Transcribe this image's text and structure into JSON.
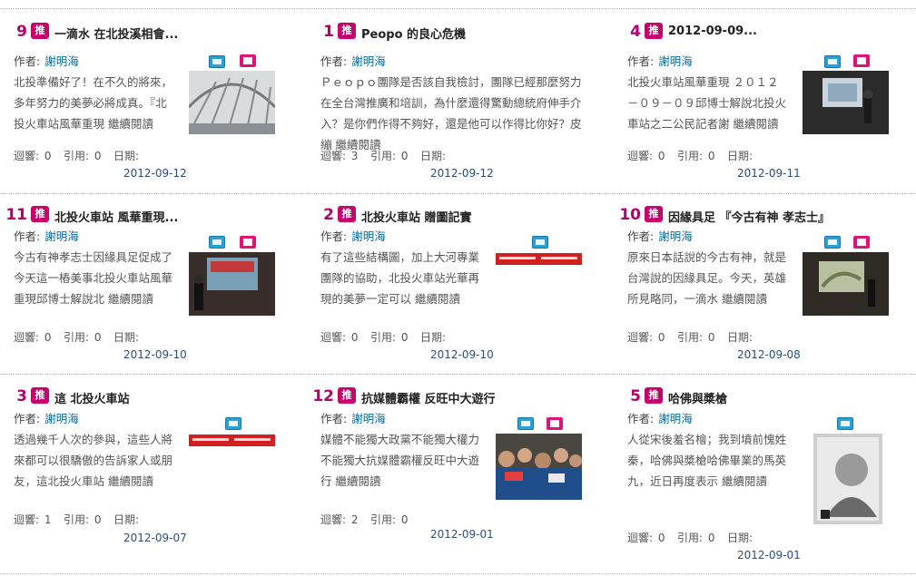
{
  "tui_label": "推",
  "author_label": "作者:",
  "reply_label": "迴響:",
  "cite_label": "引用:",
  "date_label": "日期:",
  "cards": [
    {
      "rank": "9",
      "title": "一滴水 在北投溪相會...",
      "author": "謝明海",
      "summary": "北投準備好了！在不久的將來，多年努力的美夢必將成真。『北投火車站風華重現 繼續閱讀",
      "replies": "0",
      "cites": "0",
      "date": "2012-09-12"
    },
    {
      "rank": "1",
      "title": "Peopo 的良心危機",
      "author": "謝明海",
      "summary": "Ｐｅｏｐｏ團隊是否該自我檢討，團隊已經那麼努力在全台灣推廣和培訓，為什麼還得驚動總統府伸手介入？是你們作得不夠好，還是他可以作得比你好？皮繃 繼續閱讀",
      "replies": "3",
      "cites": "0",
      "date": "2012-09-12"
    },
    {
      "rank": "4",
      "title": "2012-09-09...",
      "author": "謝明海",
      "summary": "北投火車站風華重現 ２０１２－０９－０９邱博士解說北投火車站之二公民記者謝 繼續閱讀",
      "replies": "0",
      "cites": "0",
      "date": "2012-09-11"
    },
    {
      "rank": "11",
      "title": "北投火車站 風華重現...",
      "author": "謝明海",
      "summary": "今古有神孝志士因緣具足促成了今天這一樁美事北投火車站風華重現邱博士解說北 繼續閱讀",
      "replies": "0",
      "cites": "0",
      "date": "2012-09-10"
    },
    {
      "rank": "2",
      "title": "北投火車站 贈圖記實",
      "author": "謝明海",
      "summary": "有了這些結構圖，加上大河專業團隊的協助，北投火車站光華再現的美夢一定可以 繼續閱讀",
      "replies": "0",
      "cites": "0",
      "date": "2012-09-10"
    },
    {
      "rank": "10",
      "title": "因緣具足 『今古有神 孝志士』",
      "author": "謝明海",
      "summary": "原來日本話說的今古有神，就是台灣說的因緣具足。今天，英雄所見略同，一滴水 繼續閱讀",
      "replies": "0",
      "cites": "0",
      "date": "2012-09-08"
    },
    {
      "rank": "3",
      "title": "這 北投火車站",
      "author": "謝明海",
      "summary": "透過幾千人次的參與，這些人將來都可以很驕傲的告訴家人或朋友，這北投火車站 繼續閱讀",
      "replies": "1",
      "cites": "0",
      "date": "2012-09-07"
    },
    {
      "rank": "12",
      "title": "抗媒體霸權 反旺中大遊行",
      "author": "謝明海",
      "summary": "媒體不能獨大政黨不能獨大權力不能獨大抗媒體霸權反旺中大遊行 繼續閱讀",
      "replies": "2",
      "cites": "0",
      "date": "2012-09-01"
    },
    {
      "rank": "5",
      "title": "哈佛與槳槍",
      "author": "謝明海",
      "summary": "人從宋後羞名檜；我到墳前愧姓秦，哈佛與槳槍哈佛畢業的馬英九，近日再度表示 繼續閱讀",
      "replies": "0",
      "cites": "0",
      "date": "2012-09-01"
    }
  ]
}
